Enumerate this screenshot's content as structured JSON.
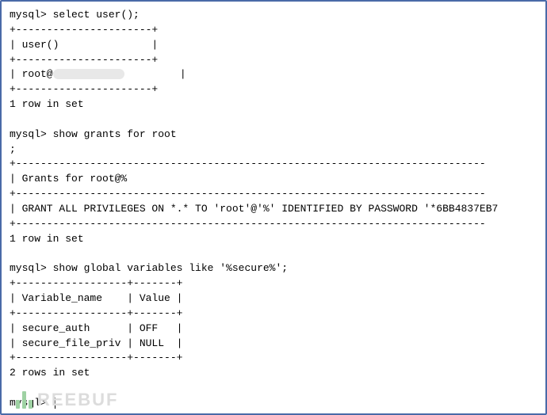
{
  "prompt": "mysql>",
  "q1": {
    "command": "select user();",
    "sep": "+----------------------+",
    "header": "| user()               |",
    "value_prefix": "| root@",
    "value_suffix": "         |",
    "footer": "1 row in set"
  },
  "q2": {
    "command": "show grants for root",
    "semicolon": ";",
    "sep_long": "+----------------------------------------------------------------------------",
    "header": "| Grants for root@%",
    "row": "| GRANT ALL PRIVILEGES ON *.* TO 'root'@'%' IDENTIFIED BY PASSWORD '*6BB4837EB7",
    "footer": "1 row in set"
  },
  "q3": {
    "command": "show global variables like '%secure%';",
    "sep": "+------------------+-------+",
    "header": "| Variable_name    | Value |",
    "row1": "| secure_auth      | OFF   |",
    "row2": "| secure_file_priv | NULL  |",
    "footer": "2 rows in set"
  },
  "watermark": "REEBUF"
}
